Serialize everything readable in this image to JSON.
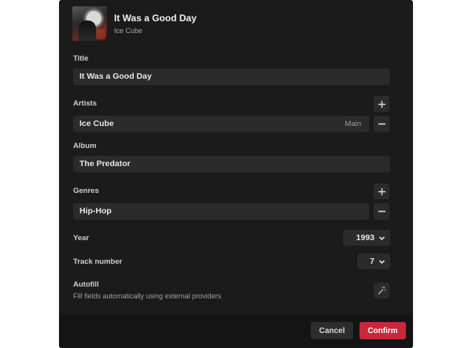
{
  "header": {
    "title": "It Was a Good Day",
    "artist": "Ice Cube"
  },
  "fields": {
    "title": {
      "label": "Title",
      "value": "It Was a Good Day"
    },
    "artists": {
      "label": "Artists",
      "items": [
        {
          "name": "Ice Cube",
          "role": "Main"
        }
      ]
    },
    "album": {
      "label": "Album",
      "value": "The Predator"
    },
    "genres": {
      "label": "Genres",
      "items": [
        {
          "name": "Hip-Hop"
        }
      ]
    },
    "year": {
      "label": "Year",
      "value": "1993"
    },
    "track_number": {
      "label": "Track number",
      "value": "7"
    },
    "autofill": {
      "label": "Autofill",
      "description": "Fill fields automatically using external providers"
    }
  },
  "footer": {
    "cancel_label": "Cancel",
    "confirm_label": "Confirm"
  },
  "colors": {
    "dialog_bg": "#1b1b1b",
    "field_bg": "#2b2b2b",
    "accent": "#c8283a",
    "footer_bg": "#141414"
  },
  "icons": [
    "plus-icon",
    "minus-icon",
    "chevron-down-icon",
    "magic-wand-icon"
  ]
}
